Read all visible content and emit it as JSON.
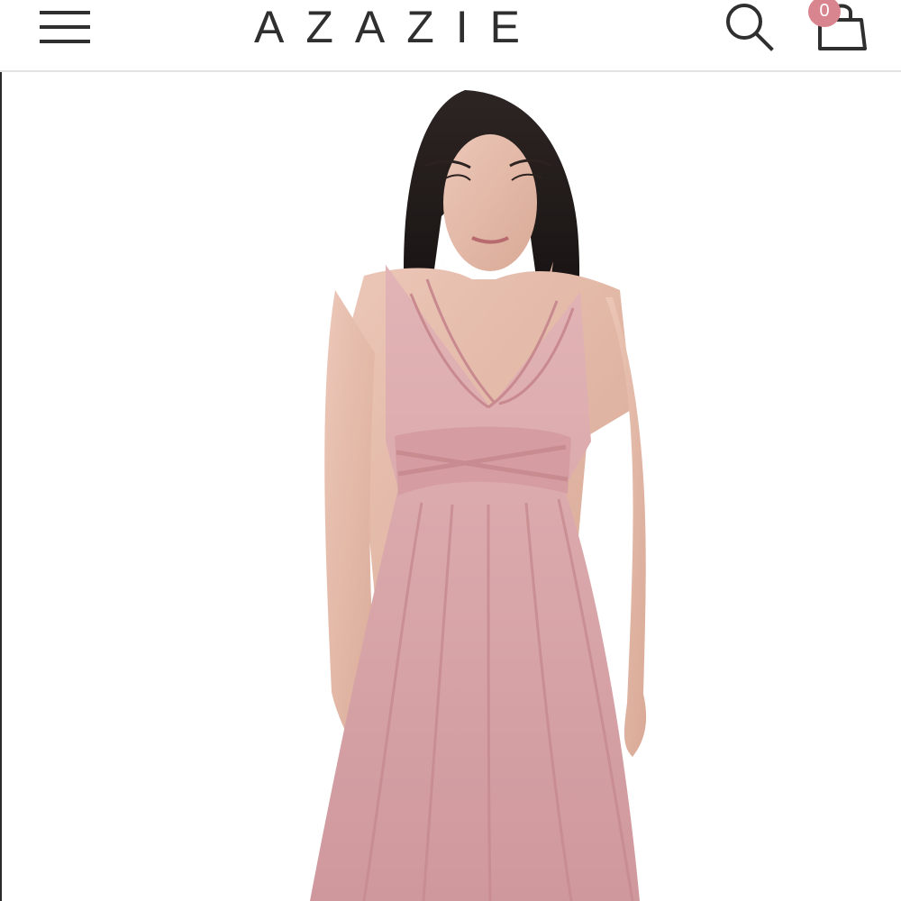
{
  "header": {
    "brand": "AZAZIE",
    "cart_count": "0",
    "menu_icon": "hamburger-menu-icon",
    "search_icon": "search-icon",
    "cart_icon": "shopping-bag-icon"
  },
  "colors": {
    "text": "#2f2f2f",
    "badge": "#d9858f",
    "dress": "#d8a4a8",
    "background": "#ffffff"
  }
}
